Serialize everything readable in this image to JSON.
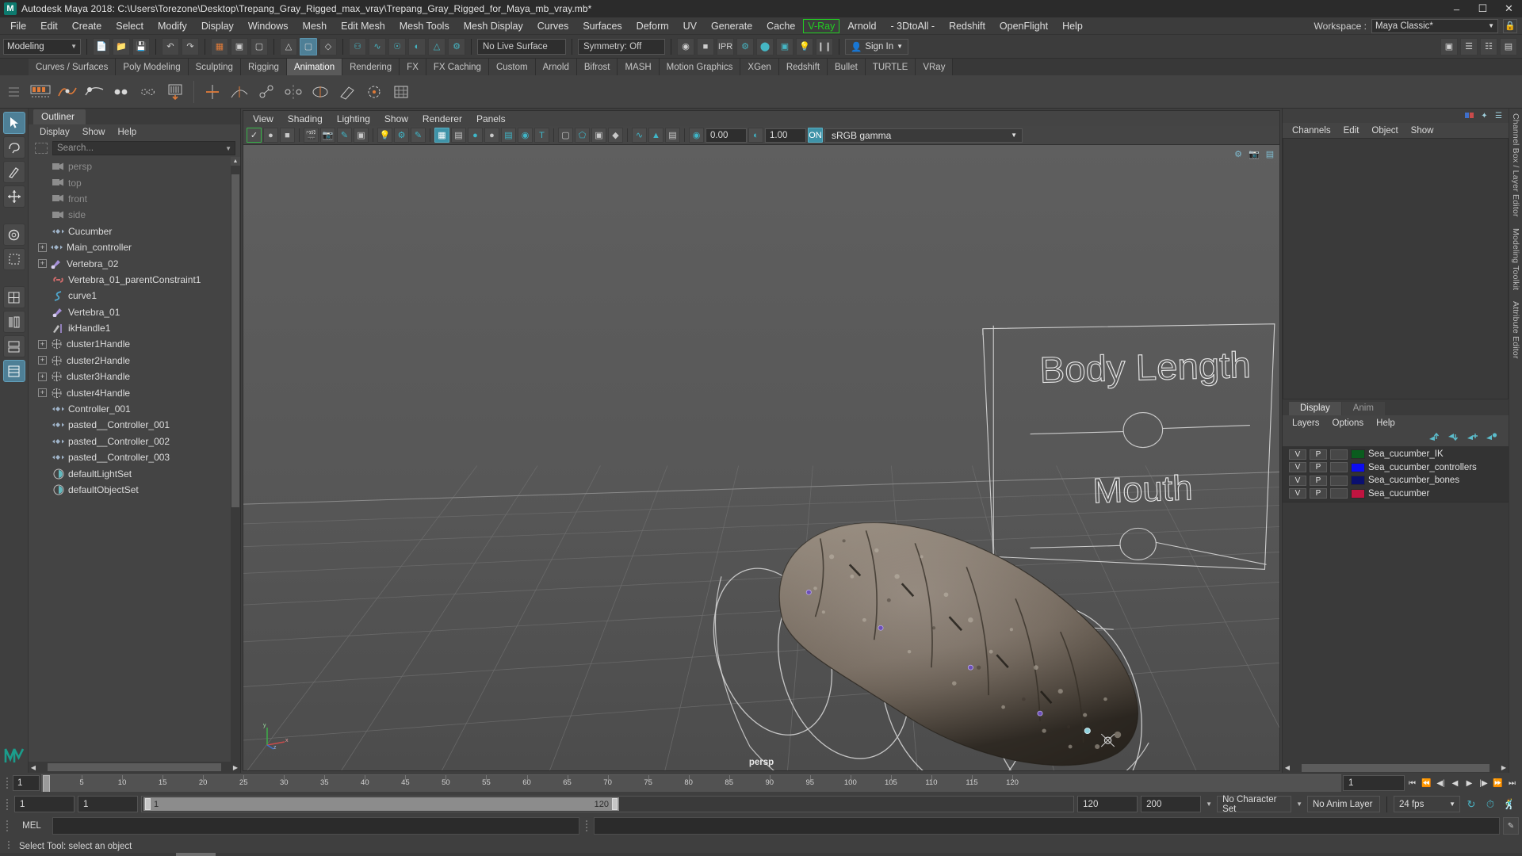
{
  "window": {
    "title": "Autodesk Maya 2018: C:\\Users\\Torezone\\Desktop\\Trepang_Gray_Rigged_max_vray\\Trepang_Gray_Rigged_for_Maya_mb_vray.mb*",
    "logo_letter": "M",
    "minimize": "–",
    "maximize": "☐",
    "close": "✕"
  },
  "menubar": {
    "items": [
      {
        "label": "File"
      },
      {
        "label": "Edit"
      },
      {
        "label": "Create"
      },
      {
        "label": "Select"
      },
      {
        "label": "Modify"
      },
      {
        "label": "Display"
      },
      {
        "label": "Windows"
      },
      {
        "label": "Mesh"
      },
      {
        "label": "Edit Mesh"
      },
      {
        "label": "Mesh Tools"
      },
      {
        "label": "Mesh Display"
      },
      {
        "label": "Curves"
      },
      {
        "label": "Surfaces"
      },
      {
        "label": "Deform"
      },
      {
        "label": "UV"
      },
      {
        "label": "Generate"
      },
      {
        "label": "Cache"
      },
      {
        "label": "V-Ray",
        "highlight": true
      },
      {
        "label": "Arnold"
      },
      {
        "label": "- 3DtoAll -"
      },
      {
        "label": "Redshift"
      },
      {
        "label": "OpenFlight"
      },
      {
        "label": "Help"
      }
    ],
    "workspace_label": "Workspace :",
    "workspace_value": "Maya Classic*",
    "lock_icon": "🔒"
  },
  "statusline": {
    "mode_value": "Modeling",
    "no_live_surface": "No Live Surface",
    "symmetry": "Symmetry: Off",
    "signin": "Sign In",
    "signin_icon": "👤",
    "playback_pause": "❙❙",
    "snap_icons": [
      "grid-snap",
      "curve-snap",
      "point-snap",
      "projection-snap",
      "view-plane-snap"
    ],
    "render_icons": [
      "render-current-frame",
      "ipr-render",
      "render-settings",
      "hypershade",
      "render-view",
      "light-editor"
    ]
  },
  "shelf": {
    "tabs": [
      {
        "label": "Curves / Surfaces"
      },
      {
        "label": "Poly Modeling"
      },
      {
        "label": "Sculpting"
      },
      {
        "label": "Rigging"
      },
      {
        "label": "Animation",
        "active": true
      },
      {
        "label": "Rendering"
      },
      {
        "label": "FX"
      },
      {
        "label": "FX Caching"
      },
      {
        "label": "Custom"
      },
      {
        "label": "Arnold"
      },
      {
        "label": "Bifrost"
      },
      {
        "label": "MASH"
      },
      {
        "label": "Motion Graphics"
      },
      {
        "label": "XGen"
      },
      {
        "label": "Redshift"
      },
      {
        "label": "Bullet"
      },
      {
        "label": "TURTLE"
      },
      {
        "label": "VRay"
      }
    ]
  },
  "outliner": {
    "tab_label": "Outliner",
    "menus": [
      {
        "label": "Display"
      },
      {
        "label": "Show"
      },
      {
        "label": "Help"
      }
    ],
    "search_placeholder": "Search...",
    "items": [
      {
        "label": "persp",
        "icon": "camera",
        "expand": "",
        "dim": true,
        "indent": 1
      },
      {
        "label": "top",
        "icon": "camera",
        "expand": "",
        "dim": true,
        "indent": 1
      },
      {
        "label": "front",
        "icon": "camera",
        "expand": "",
        "dim": true,
        "indent": 1
      },
      {
        "label": "side",
        "icon": "camera",
        "expand": "",
        "dim": true,
        "indent": 1
      },
      {
        "label": "Cucumber",
        "icon": "transform",
        "expand": "",
        "dim": false,
        "indent": 1
      },
      {
        "label": "Main_controller",
        "icon": "transform",
        "expand": "+",
        "dim": false,
        "indent": 0
      },
      {
        "label": "Vertebra_02",
        "icon": "joint",
        "expand": "+",
        "dim": false,
        "indent": 0
      },
      {
        "label": "Vertebra_01_parentConstraint1",
        "icon": "constraint",
        "expand": "",
        "dim": false,
        "indent": 1
      },
      {
        "label": "curve1",
        "icon": "curve",
        "expand": "",
        "dim": false,
        "indent": 1
      },
      {
        "label": "Vertebra_01",
        "icon": "joint",
        "expand": "",
        "dim": false,
        "indent": 1
      },
      {
        "label": "ikHandle1",
        "icon": "ikhandle",
        "expand": "",
        "dim": false,
        "indent": 1
      },
      {
        "label": "cluster1Handle",
        "icon": "cluster",
        "expand": "+",
        "dim": false,
        "indent": 0
      },
      {
        "label": "cluster2Handle",
        "icon": "cluster",
        "expand": "+",
        "dim": false,
        "indent": 0
      },
      {
        "label": "cluster3Handle",
        "icon": "cluster",
        "expand": "+",
        "dim": false,
        "indent": 0
      },
      {
        "label": "cluster4Handle",
        "icon": "cluster",
        "expand": "+",
        "dim": false,
        "indent": 0
      },
      {
        "label": "Controller_001",
        "icon": "transform",
        "expand": "",
        "dim": false,
        "indent": 1
      },
      {
        "label": "pasted__Controller_001",
        "icon": "transform",
        "expand": "",
        "dim": false,
        "indent": 1
      },
      {
        "label": "pasted__Controller_002",
        "icon": "transform",
        "expand": "",
        "dim": false,
        "indent": 1
      },
      {
        "label": "pasted__Controller_003",
        "icon": "transform",
        "expand": "",
        "dim": false,
        "indent": 1
      },
      {
        "label": "defaultLightSet",
        "icon": "set",
        "expand": "",
        "dim": false,
        "indent": 1
      },
      {
        "label": "defaultObjectSet",
        "icon": "set",
        "expand": "",
        "dim": false,
        "indent": 1
      }
    ]
  },
  "viewport": {
    "menus": [
      {
        "label": "View"
      },
      {
        "label": "Shading"
      },
      {
        "label": "Lighting"
      },
      {
        "label": "Show"
      },
      {
        "label": "Renderer"
      },
      {
        "label": "Panels"
      }
    ],
    "exposure_value": "0.00",
    "gamma_value": "1.00",
    "color_management": "sRGB gamma",
    "camera_label": "persp",
    "annotations": [
      {
        "text": "Body Length"
      },
      {
        "text": "Mouth"
      }
    ],
    "axis_labels": [
      "y",
      "x",
      "z"
    ]
  },
  "channelbox": {
    "menus": [
      {
        "label": "Channels"
      },
      {
        "label": "Edit"
      },
      {
        "label": "Object"
      },
      {
        "label": "Show"
      }
    ]
  },
  "layers": {
    "tabs": [
      {
        "label": "Display",
        "active": true
      },
      {
        "label": "Anim",
        "active": false
      }
    ],
    "menus": [
      {
        "label": "Layers"
      },
      {
        "label": "Options"
      },
      {
        "label": "Help"
      }
    ],
    "buttons": [
      "move-layer-up-icon",
      "move-layer-down-icon",
      "new-layer-icon",
      "new-layer-from-selected-icon"
    ],
    "rows": [
      {
        "v": "V",
        "p": "P",
        "color": "#0a5c1e",
        "name": "Sea_cucumber_IK"
      },
      {
        "v": "V",
        "p": "P",
        "color": "#0d0df0",
        "name": "Sea_cucumber_controllers"
      },
      {
        "v": "V",
        "p": "P",
        "color": "#0a1070",
        "name": "Sea_cucumber_bones"
      },
      {
        "v": "V",
        "p": "P",
        "color": "#c01440",
        "name": "Sea_cucumber"
      }
    ]
  },
  "edge_tabs": [
    {
      "label": "Channel Box / Layer Editor"
    },
    {
      "label": "Modeling Toolkit"
    },
    {
      "label": "Attribute Editor"
    }
  ],
  "timeslider": {
    "current_frame": "1",
    "ticks": [
      5,
      10,
      15,
      20,
      25,
      30,
      35,
      40,
      45,
      50,
      55,
      60,
      65,
      70,
      75,
      80,
      85,
      90,
      95,
      100,
      105,
      110,
      115,
      120
    ],
    "playhead_frame": "1",
    "end_field": "1",
    "playback_buttons": [
      "go-to-start",
      "step-back-key",
      "step-back-frame",
      "play-backwards",
      "play-forwards",
      "step-forward-frame",
      "step-forward-key",
      "go-to-end"
    ]
  },
  "rangeslider": {
    "start": "1",
    "anim_start": "1",
    "range_start_label": "1",
    "range_end_label": "120",
    "anim_end": "120",
    "end": "200",
    "character_set": "No Character Set",
    "anim_layer": "No Anim Layer",
    "fps": "24 fps",
    "icons": [
      "auto-key-icon",
      "animation-preferences-icon",
      "character-icon"
    ]
  },
  "commandline": {
    "language_label": "MEL",
    "input_value": "",
    "output_value": "",
    "script_editor_icon": "script-editor"
  },
  "helpline": {
    "text": "Select Tool: select an object"
  },
  "toolbox": {
    "tools": [
      {
        "name": "select-tool",
        "glyph": "↖",
        "active": true
      },
      {
        "name": "lasso-tool",
        "glyph": "❀",
        "active": false
      },
      {
        "name": "paint-select-tool",
        "glyph": "✎",
        "active": false
      },
      {
        "name": "move-tool",
        "glyph": "✛",
        "active": false
      },
      {
        "name": "rotate-tool",
        "glyph": "◈",
        "active": false
      },
      {
        "name": "scale-tool",
        "glyph": "▣",
        "active": false
      },
      {
        "name": "last-tool",
        "glyph": "❖",
        "active": false
      },
      {
        "name": "layout-single",
        "glyph": "▦",
        "active": false
      },
      {
        "name": "layout-two-pane",
        "glyph": "◫",
        "active": false
      },
      {
        "name": "layout-four-pane",
        "glyph": "☰",
        "active": true
      }
    ]
  }
}
